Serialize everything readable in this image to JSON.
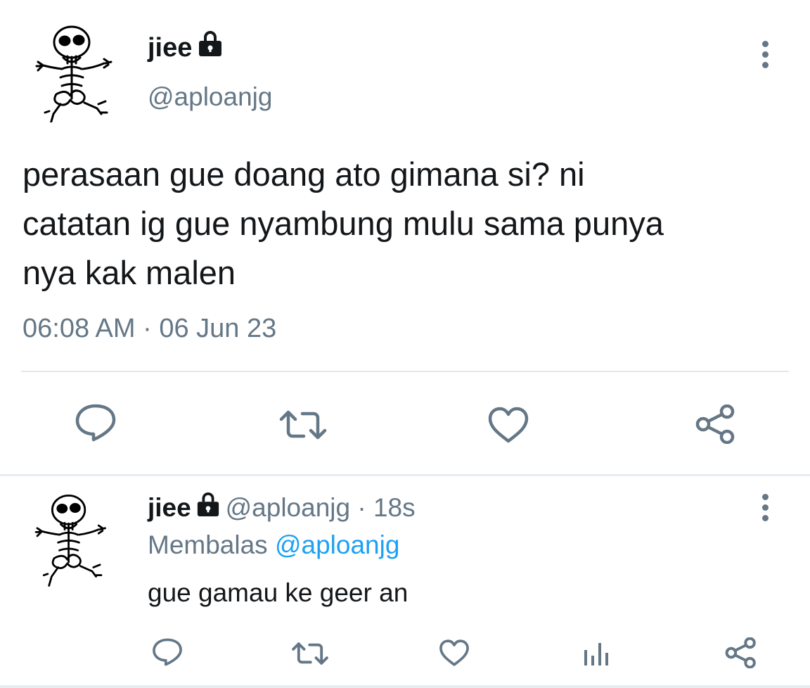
{
  "main_tweet": {
    "display_name": "jiee",
    "handle": "@aploanjg",
    "text_lines": [
      "perasaan gue doang ato gimana si? ni",
      "catatan ig gue nyambung mulu sama punya",
      "nya kak malen"
    ],
    "timestamp": "06:08 AM · 06 Jun 23",
    "actions": [
      "reply-icon",
      "retweet-icon",
      "like-icon",
      "share-icon"
    ]
  },
  "reply_tweet": {
    "display_name": "jiee",
    "handle_time": "@aploanjg · 18s",
    "replying_prefix": "Membalas ",
    "replying_to": "@aploanjg",
    "text": "gue gamau ke geer an",
    "actions": [
      "reply-icon",
      "retweet-icon",
      "like-icon",
      "analytics-icon",
      "share-icon"
    ]
  },
  "colors": {
    "text": "#14171a",
    "secondary": "#657786",
    "link": "#1da1f2",
    "divider": "#e1e8ed"
  }
}
